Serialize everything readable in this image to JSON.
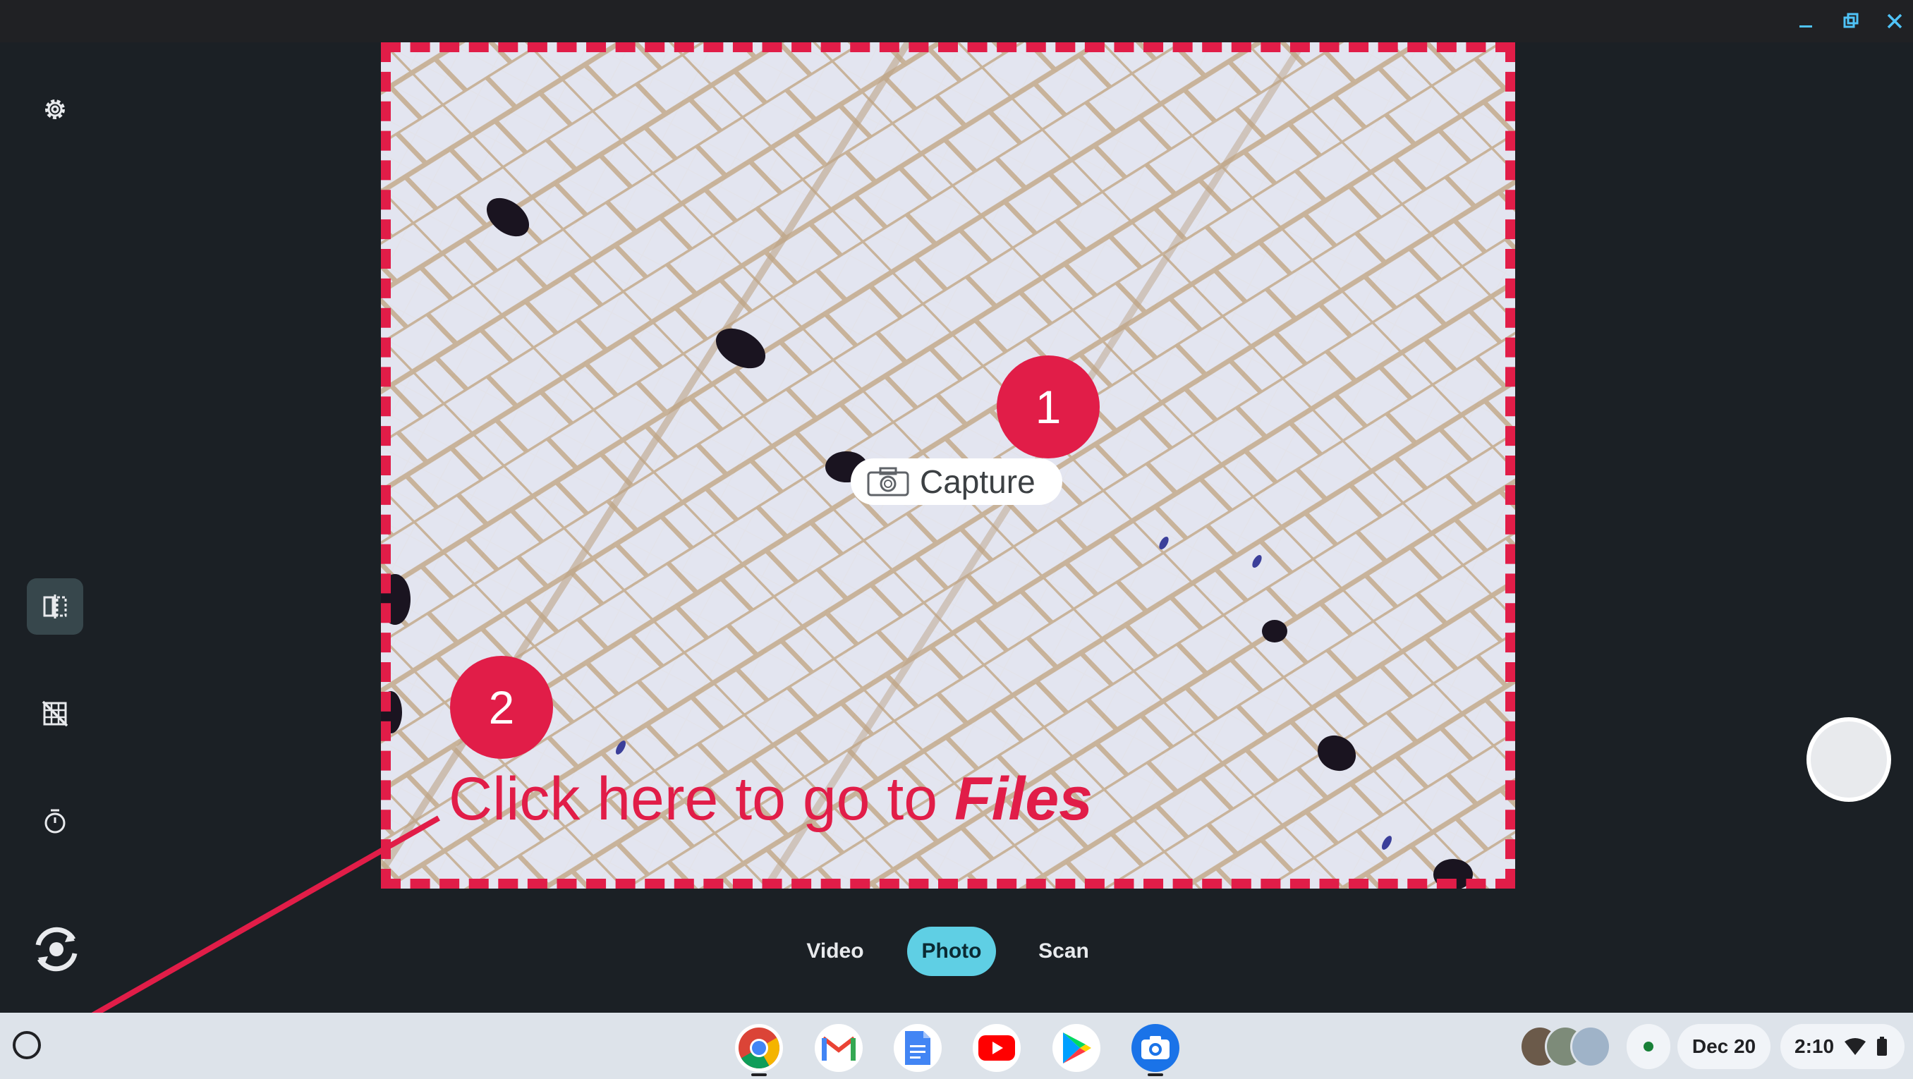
{
  "window": {
    "minimize_icon": "minimize-icon",
    "restore_icon": "restore-icon",
    "close_icon": "close-icon",
    "accent": "#4fc3f7"
  },
  "toolbar": {
    "settings_icon": "gear-icon",
    "mirror_icon": "mirror-icon",
    "grid_icon": "grid-off-icon",
    "timer_icon": "timer-icon",
    "switch_camera_icon": "switch-camera-icon"
  },
  "preview": {
    "capture_label": "Capture",
    "capture_icon": "camera-icon"
  },
  "annotations": {
    "marker_1": "1",
    "marker_2": "2",
    "instruction_prefix": "Click here to go to ",
    "instruction_emphasis": "Files",
    "color": "#e11d48"
  },
  "modes": {
    "items": [
      "Video",
      "Photo",
      "Scan"
    ],
    "selected": "Photo"
  },
  "shelf": {
    "apps": [
      "Chrome",
      "Gmail",
      "Docs",
      "YouTube",
      "Play Store",
      "Camera"
    ],
    "date": "Dec 20",
    "time": "2:10"
  }
}
